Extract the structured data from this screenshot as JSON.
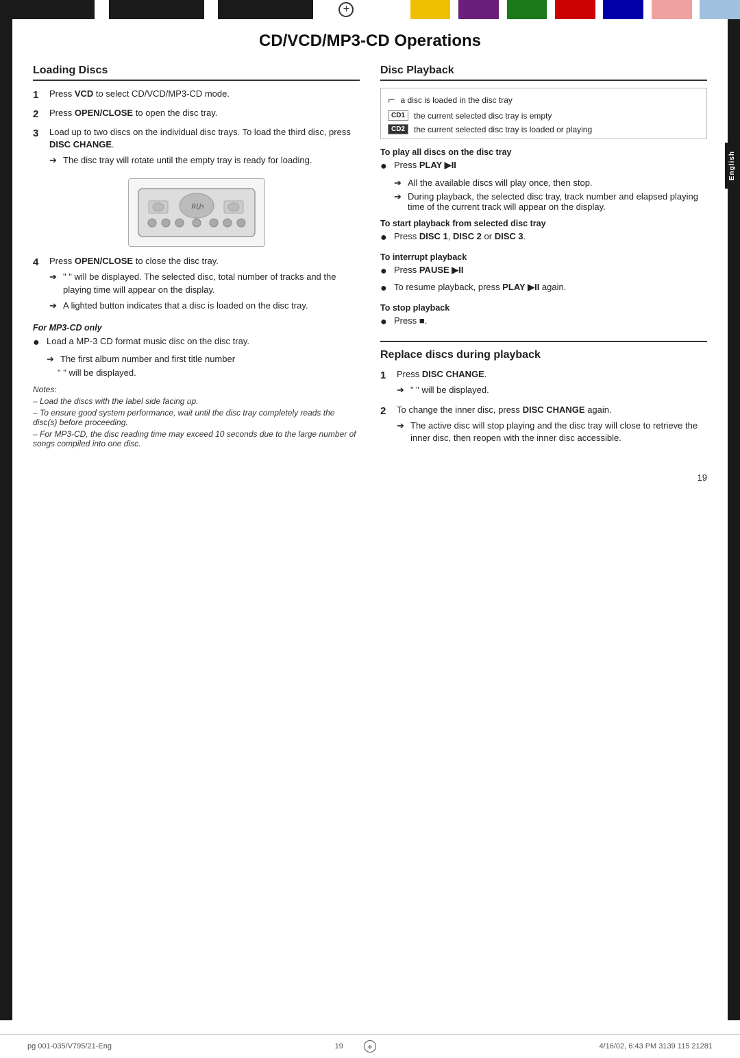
{
  "page": {
    "title": "CD/VCD/MP3-CD Operations",
    "number": "19",
    "footer_left": "pg 001-035/V795/21-Eng",
    "footer_center_num": "19",
    "footer_right": "4/16/02, 6:43 PM  3139 115 21281"
  },
  "loading_discs": {
    "title": "Loading Discs",
    "steps": [
      {
        "num": "1",
        "text": "Press VCD to select CD/VCD/MP3-CD mode."
      },
      {
        "num": "2",
        "text": "Press OPEN/CLOSE to open the disc tray."
      },
      {
        "num": "3",
        "text": "Load up to two discs on the individual disc trays. To load the third disc, press DISC CHANGE.",
        "arrow": "The disc tray will rotate until the empty tray is ready for loading."
      }
    ],
    "step4": {
      "num": "4",
      "text": "Press OPEN/CLOSE to close the disc tray.",
      "arrow1": "\" \" will be displayed. The selected disc, total number of tracks and the playing time will appear on the display.",
      "arrow2": "A lighted button indicates that a disc is loaded on the disc tray."
    },
    "for_mp3_title": "For MP3-CD only",
    "for_mp3_bullet": "Load a MP-3 CD format music disc on the disc tray.",
    "for_mp3_arrow1": "The first album number and first title number",
    "for_mp3_arrow2": "\" \" will be displayed.",
    "notes_title": "Notes:",
    "notes": [
      "– Load the discs with the label side facing up.",
      "– To ensure good system performance, wait until the disc tray completely reads the disc(s) before proceeding.",
      "– For MP3-CD, the disc reading time may exceed 10 seconds due to the large number of songs compiled into one disc."
    ]
  },
  "disc_playback": {
    "title": "Disc Playback",
    "icons": [
      {
        "badge": "⌐",
        "badge_type": "open",
        "desc": "a disc is loaded in the disc tray"
      },
      {
        "badge": "CD1",
        "badge_type": "text",
        "desc": "the current selected disc tray is empty"
      },
      {
        "badge": "CD2",
        "badge_type": "text",
        "desc": "the current selected disc tray is loaded or playing"
      }
    ],
    "sections": [
      {
        "title": "To play all discs on the disc tray",
        "bullets": [
          {
            "text": "Press PLAY ▶II"
          },
          {
            "arrow": "All the available discs will play once, then stop."
          },
          {
            "arrow": "During playback, the selected disc tray, track number and elapsed playing time of the current track will appear on the display."
          }
        ]
      },
      {
        "title": "To start playback from selected disc tray",
        "bullets": [
          {
            "text": "Press DISC 1, DISC 2 or DISC 3."
          }
        ]
      },
      {
        "title": "To interrupt playback",
        "bullets": [
          {
            "text": "Press PAUSE ▶II"
          },
          {
            "text": "To resume playback, press PLAY ▶II again."
          }
        ]
      },
      {
        "title": "To stop playback",
        "bullets": [
          {
            "text": "Press ■."
          }
        ]
      }
    ]
  },
  "replace_discs": {
    "title": "Replace discs during playback",
    "steps": [
      {
        "num": "1",
        "text": "Press DISC CHANGE.",
        "arrow": "\" \" will be displayed."
      },
      {
        "num": "2",
        "text": "To change the inner disc, press DISC CHANGE again.",
        "arrow": "The active disc will stop playing and the disc tray will close to retrieve the inner disc, then reopen with the inner disc accessible."
      }
    ]
  },
  "english_tab": "English"
}
